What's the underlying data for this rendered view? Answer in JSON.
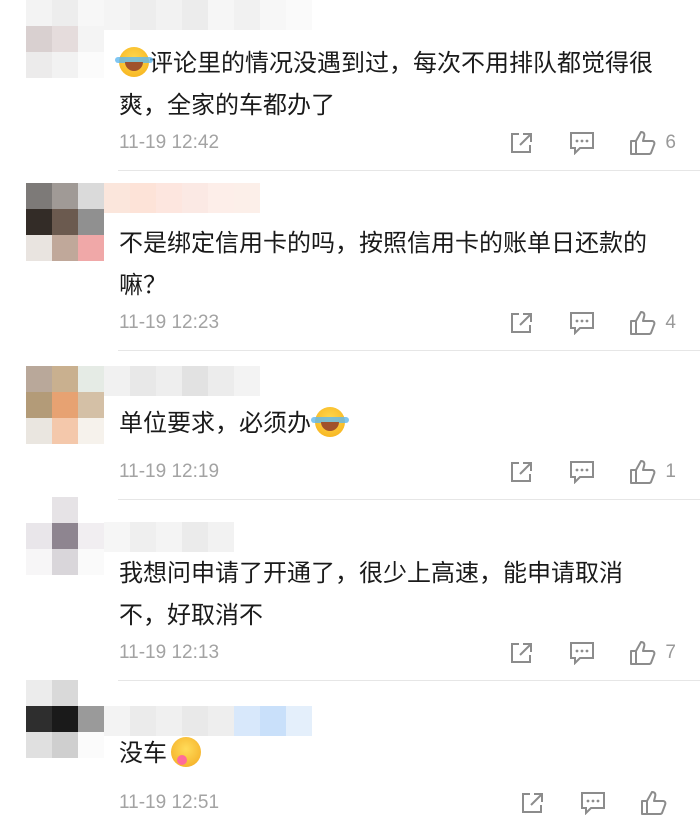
{
  "comments": [
    {
      "text_before": "",
      "text": "评论里的情况没遇到过，每次不用排队都觉得很爽，全家的车都办了",
      "emoji_before": "laugh-emoji",
      "emoji_after": "",
      "time": "11-19 12:42",
      "likes": "6"
    },
    {
      "text": "不是绑定信用卡的吗，按照信用卡的账单日还款的嘛？",
      "emoji_before": "",
      "emoji_after": "",
      "time": "11-19 12:23",
      "likes": "4"
    },
    {
      "text": "单位要求，必须办",
      "emoji_before": "",
      "emoji_after": "laugh-emoji",
      "time": "11-19 12:19",
      "likes": "1"
    },
    {
      "text": "我想问申请了开通了，很少上高速，能申请取消不，好取消不",
      "emoji_before": "",
      "emoji_after": "",
      "time": "11-19 12:13",
      "likes": "7"
    },
    {
      "text": "没车",
      "emoji_before": "",
      "emoji_after": "yum-emoji",
      "time": "11-19 12:51",
      "likes": ""
    }
  ],
  "icons": {
    "share": "share-icon",
    "reply": "comment-icon",
    "like": "thumbs-up-icon"
  },
  "colors": {
    "meta_text": "#a3a3a3",
    "divider": "#e6e6e6",
    "icon_gray": "#8c8c8c"
  }
}
